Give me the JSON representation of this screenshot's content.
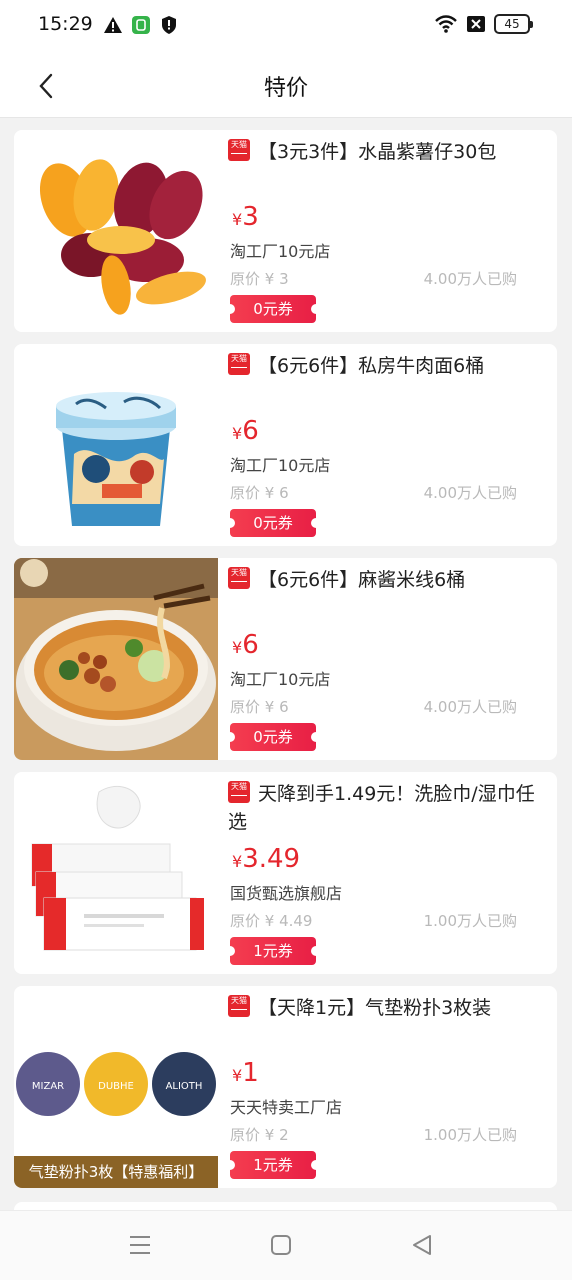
{
  "status_bar": {
    "time": "15:29",
    "battery": "45",
    "icons": [
      "warning-icon",
      "wechat-icon",
      "shield-icon",
      "wifi-icon",
      "sim-off-icon",
      "battery-icon"
    ]
  },
  "nav": {
    "back_icon": "chevron-left-icon",
    "title": "特价"
  },
  "colors": {
    "accent": "#e4262d",
    "coupon": "#f43d4f",
    "muted": "#b9b9b9"
  },
  "products": [
    {
      "badge": "天猫",
      "title": "【3元3件】水晶紫薯仔30包",
      "currency": "¥",
      "price": "3",
      "shop": "淘工厂10元店",
      "original_price": "原价 ¥ 3",
      "sold": "4.00万人已购",
      "coupon": "0元券"
    },
    {
      "badge": "天猫",
      "title": "【6元6件】私房牛肉面6桶",
      "currency": "¥",
      "price": "6",
      "shop": "淘工厂10元店",
      "original_price": "原价 ¥ 6",
      "sold": "4.00万人已购",
      "coupon": "0元券"
    },
    {
      "badge": "天猫",
      "title": "【6元6件】麻酱米线6桶",
      "currency": "¥",
      "price": "6",
      "shop": "淘工厂10元店",
      "original_price": "原价 ¥ 6",
      "sold": "4.00万人已购",
      "coupon": "0元券"
    },
    {
      "badge": "天猫",
      "title": "天降到手1.49元！洗脸巾/湿巾任选",
      "currency": "¥",
      "price": "3.49",
      "shop": "国货甄选旗舰店",
      "original_price": "原价 ¥ 4.49",
      "sold": "1.00万人已购",
      "coupon": "1元券"
    },
    {
      "badge": "天猫",
      "title": "【天降1元】气垫粉扑3枚装",
      "currency": "¥",
      "price": "1",
      "shop": "天天特卖工厂店",
      "original_price": "原价 ¥ 2",
      "sold": "1.00万人已购",
      "coupon": "1元券",
      "thumb_banner": "气垫粉扑3枚【特惠福利】",
      "thumb_puffs": [
        "MIZAR",
        "DUBHE",
        "ALIOTH"
      ]
    }
  ],
  "system_nav": {
    "icons": [
      "menu-icon",
      "home-icon",
      "back-triangle-icon"
    ]
  }
}
